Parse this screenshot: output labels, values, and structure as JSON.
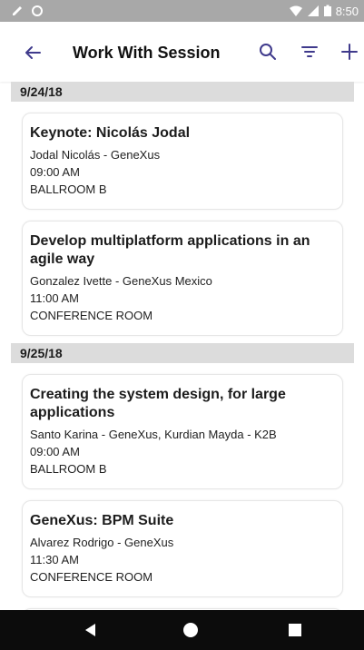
{
  "status_bar": {
    "time": "8:50",
    "battery_icon": "battery-icon",
    "signal_icon": "signal-icon"
  },
  "app_bar": {
    "title": "Work With Session",
    "back_icon": "arrow-left-icon",
    "search_icon": "search-icon",
    "filter_icon": "filter-icon",
    "add_icon": "plus-icon"
  },
  "groups": [
    {
      "date": "9/24/18",
      "sessions": [
        {
          "title": "Keynote: Nicolás Jodal",
          "speaker": "Jodal Nicolás - GeneXus",
          "time": "09:00 AM",
          "room": "BALLROOM B"
        },
        {
          "title": "Develop multiplatform applications in an agile way",
          "speaker": "Gonzalez Ivette - GeneXus Mexico",
          "time": "11:00 AM",
          "room": "CONFERENCE ROOM"
        }
      ]
    },
    {
      "date": "9/25/18",
      "sessions": [
        {
          "title": "Creating the system design, for large applications",
          "speaker": "Santo Karina - GeneXus, Kurdian Mayda - K2B",
          "time": "09:00 AM",
          "room": "BALLROOM B"
        },
        {
          "title": "GeneXus: BPM Suite",
          "speaker": "Alvarez Rodrigo - GeneXus",
          "time": "11:30 AM",
          "room": "CONFERENCE ROOM"
        }
      ]
    }
  ],
  "colors": {
    "accent": "#3f3a8c",
    "status_bar": "#a8a8a8",
    "nav_bar": "#0c0c0c",
    "date_header": "#dcdcdc"
  }
}
